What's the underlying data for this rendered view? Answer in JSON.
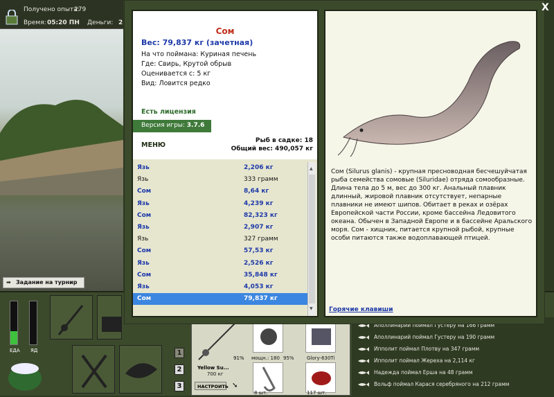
{
  "status": {
    "xp_label": "Получено опыта:",
    "xp_value": "279",
    "time_label": "Время:",
    "time_value": "05:20 ПН",
    "money_label": "Деньги:",
    "money_value": "2"
  },
  "task_button": "Задание на турнир",
  "fish": {
    "name": "Сом",
    "weight": "Вес: 79,837 кг (зачетная)",
    "bait": "На что поймана: Куриная печень",
    "place": "Где: Свирь, Крутой обрыв",
    "valued": "Оценивается с: 5 кг",
    "kind": "Вид: Ловится редко"
  },
  "license": "Есть лицензия",
  "version_label": "Версия игры: ",
  "version_value": "3.7.6",
  "menu": "МЕНЮ",
  "keepnet": {
    "count_line": "Рыб в садке: 18",
    "total_line": "Общий вес: 490,057 кг"
  },
  "catches": [
    {
      "name": "Язь",
      "weight": "2,206 кг",
      "bold": true
    },
    {
      "name": "Язь",
      "weight": "333 грамм",
      "bold": false
    },
    {
      "name": "Сом",
      "weight": "8,64 кг",
      "bold": true
    },
    {
      "name": "Язь",
      "weight": "4,239 кг",
      "bold": true
    },
    {
      "name": "Сом",
      "weight": "82,323 кг",
      "bold": true
    },
    {
      "name": "Язь",
      "weight": "2,907 кг",
      "bold": true
    },
    {
      "name": "Язь",
      "weight": "327 грамм",
      "bold": false
    },
    {
      "name": "Сом",
      "weight": "57,53 кг",
      "bold": true
    },
    {
      "name": "Язь",
      "weight": "2,526 кг",
      "bold": true
    },
    {
      "name": "Сом",
      "weight": "35,848 кг",
      "bold": true
    },
    {
      "name": "Язь",
      "weight": "4,053 кг",
      "bold": true
    },
    {
      "name": "Сом",
      "weight": "79,837 кг",
      "bold": true,
      "selected": true
    }
  ],
  "description": "Сом (Silurus glanis) - крупная пресноводная бесчешуйчатая рыба семейства сомовые (Siluridae) отряда сомообразные. Длина тела до 5 м, вес до 300 кг. Анальный плавник длинный, жировой плавник отсутствует, непарные плавники не имеют шипов. Обитает в реках и озёрах Европейской части России, кроме бассейна Ледовитого океана. Обычен в Западной Европе и в бассейне Аральского моря. Сом - хищник, питается крупной рыбой, крупные особи питаются также водоплавающей птицей.",
  "hotkeys": "Горячие клавиши",
  "close": "X",
  "gauges": {
    "food_label": "ЕДА",
    "poison_label": "ЯД",
    "food_level": 0.3,
    "poison_level": 0
  },
  "pages": [
    "1",
    "2",
    "3"
  ],
  "gear": {
    "rod_name": "Yellow Su...",
    "rod_test": "700 кг",
    "rod_pct": "91%",
    "setup": "НАСТРОИТЬ",
    "reel_power": "мощн.: 180",
    "reel_pct": "95%",
    "line_name": "Glory-630Ti",
    "hook_count": "8 шт.",
    "bait_count": "117 шт."
  },
  "log": [
    "Аполлинарий поймал Густеру на 166 грамм",
    "Аполлинарий поймал Густеру на 190 грамм",
    "Ипполит поймал Плотву на 347 грамм",
    "Ипполит поймал Жереха на 2,114 кг",
    "Надежда поймал Ерша на 48 грамм",
    "Вольф поймал Карася серебряного на 212 грамм"
  ]
}
